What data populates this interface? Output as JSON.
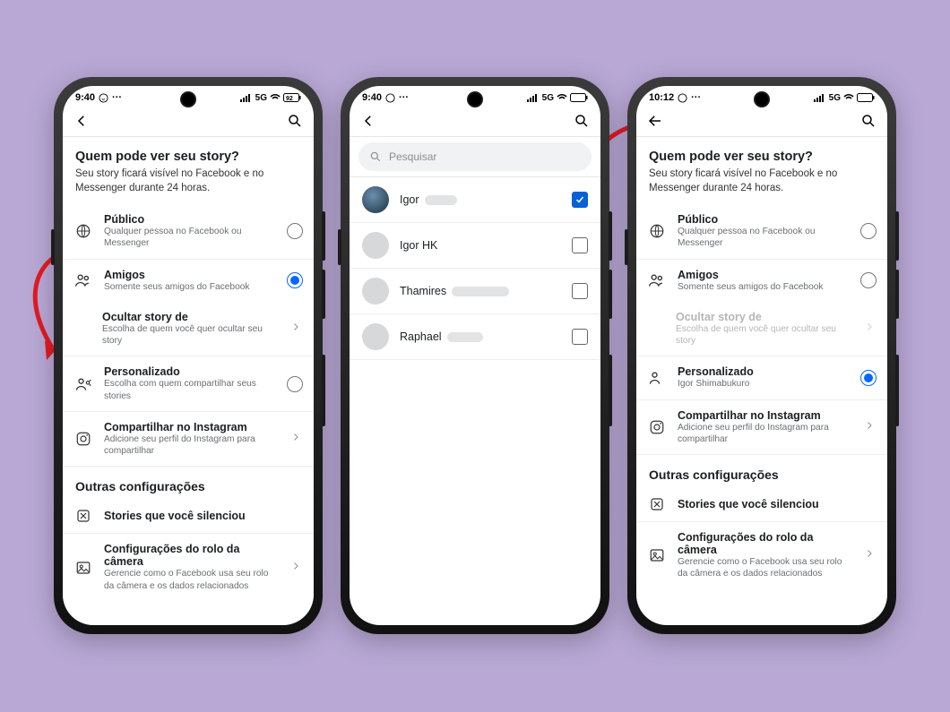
{
  "status": {
    "time1": "9:40",
    "time2": "9:40",
    "time3": "10:12",
    "net": "5G",
    "battery": "92"
  },
  "screen1": {
    "heading": "Quem pode ver seu story?",
    "sub": "Seu story ficará visível no Facebook e no Messenger durante 24 horas.",
    "public": {
      "title": "Público",
      "sub": "Qualquer pessoa no Facebook ou Messenger"
    },
    "friends": {
      "title": "Amigos",
      "sub": "Somente seus amigos do Facebook"
    },
    "hide": {
      "title": "Ocultar story de",
      "sub": "Escolha de quem você quer ocultar seu story"
    },
    "custom": {
      "title": "Personalizado",
      "sub": "Escolha com quem compartilhar seus stories"
    },
    "insta": {
      "title": "Compartilhar no Instagram",
      "sub": "Adicione seu perfil do Instagram para compartilhar"
    },
    "other": "Outras configurações",
    "muted": "Stories que você silenciou",
    "camera": {
      "title": "Configurações do rolo da câmera",
      "sub": "Gerencie como o Facebook usa seu rolo da câmera e os dados relacionados"
    },
    "selected": "friends"
  },
  "screen2": {
    "searchPlaceholder": "Pesquisar",
    "users": [
      {
        "name": "Igor",
        "avatar": "av1",
        "checked": true,
        "blur": "bp36"
      },
      {
        "name": "Igor HK",
        "avatar": "avg",
        "checked": false,
        "blur": null
      },
      {
        "name": "Thamires",
        "avatar": "avg",
        "checked": false,
        "blur": "bp64"
      },
      {
        "name": "Raphael",
        "avatar": "avg",
        "checked": false,
        "blur": "bp40"
      }
    ]
  },
  "screen3": {
    "heading": "Quem pode ver seu story?",
    "sub": "Seu story ficará visível no Facebook e no Messenger durante 24 horas.",
    "custom": {
      "title": "Personalizado",
      "sub": "Igor Shimabukuro"
    },
    "selected": "custom"
  }
}
